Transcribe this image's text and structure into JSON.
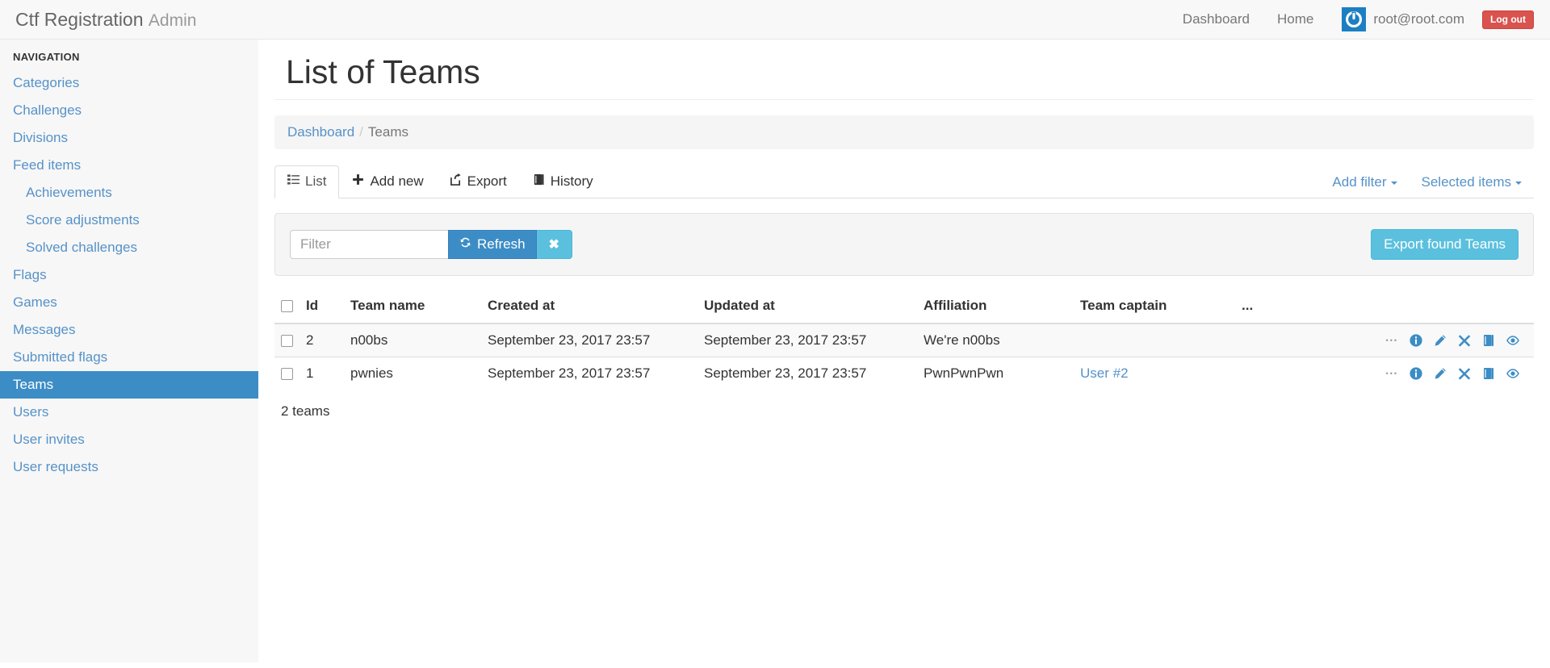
{
  "navbar": {
    "brand_main": "Ctf Registration",
    "brand_sub": "Admin",
    "links": [
      {
        "label": "Dashboard",
        "name": "nav-link-dashboard"
      },
      {
        "label": "Home",
        "name": "nav-link-home"
      }
    ],
    "user_email": "root@root.com",
    "logout_label": "Log out",
    "gravatar_icon": "power-icon",
    "accent_color": "#1b7fc4",
    "logout_color": "#d9534f"
  },
  "sidebar": {
    "header": "NAVIGATION",
    "active_color": "#3c8dc5",
    "link_color": "#5692c8",
    "items": [
      {
        "label": "Categories",
        "sub": false,
        "active": false
      },
      {
        "label": "Challenges",
        "sub": false,
        "active": false
      },
      {
        "label": "Divisions",
        "sub": false,
        "active": false
      },
      {
        "label": "Feed items",
        "sub": false,
        "active": false
      },
      {
        "label": "Achievements",
        "sub": true,
        "active": false
      },
      {
        "label": "Score adjustments",
        "sub": true,
        "active": false
      },
      {
        "label": "Solved challenges",
        "sub": true,
        "active": false
      },
      {
        "label": "Flags",
        "sub": false,
        "active": false
      },
      {
        "label": "Games",
        "sub": false,
        "active": false
      },
      {
        "label": "Messages",
        "sub": false,
        "active": false
      },
      {
        "label": "Submitted flags",
        "sub": false,
        "active": false
      },
      {
        "label": "Teams",
        "sub": false,
        "active": true
      },
      {
        "label": "Users",
        "sub": false,
        "active": false
      },
      {
        "label": "User invites",
        "sub": false,
        "active": false
      },
      {
        "label": "User requests",
        "sub": false,
        "active": false
      }
    ]
  },
  "page": {
    "title": "List of Teams"
  },
  "breadcrumb": {
    "root": "Dashboard",
    "separator": "/",
    "current": "Teams"
  },
  "tabs": [
    {
      "label": "List",
      "icon": "list-icon",
      "active": true,
      "name": "tab-list"
    },
    {
      "label": "Add new",
      "icon": "plus-icon",
      "active": false,
      "name": "tab-add-new"
    },
    {
      "label": "Export",
      "icon": "export-icon",
      "active": false,
      "name": "tab-export"
    },
    {
      "label": "History",
      "icon": "book-icon",
      "active": false,
      "name": "tab-history"
    }
  ],
  "tab_dropdowns": [
    {
      "label": "Add filter",
      "name": "add-filter-dropdown"
    },
    {
      "label": "Selected items",
      "name": "selected-items-dropdown"
    }
  ],
  "filter_panel": {
    "input_value": "",
    "input_placeholder": "Filter",
    "refresh_label": "Refresh",
    "refresh_icon": "refresh-icon",
    "clear_label": "✖",
    "export_found_label": "Export found Teams",
    "refresh_color": "#3c8dc5",
    "info_color": "#5bc0de"
  },
  "table": {
    "headers": [
      {
        "label": "",
        "name": "select-all-header"
      },
      {
        "label": "Id",
        "name": "header-id"
      },
      {
        "label": "Team name",
        "name": "header-team-name"
      },
      {
        "label": "Created at",
        "name": "header-created-at"
      },
      {
        "label": "Updated at",
        "name": "header-updated-at"
      },
      {
        "label": "Affiliation",
        "name": "header-affiliation"
      },
      {
        "label": "Team captain",
        "name": "header-team-captain"
      },
      {
        "label": "...",
        "name": "header-actions"
      }
    ],
    "rows": [
      {
        "id": "2",
        "team_name": "n00bs",
        "created_at": "September 23, 2017 23:57",
        "updated_at": "September 23, 2017 23:57",
        "affiliation": "We're n00bs",
        "team_captain": ""
      },
      {
        "id": "1",
        "team_name": "pwnies",
        "created_at": "September 23, 2017 23:57",
        "updated_at": "September 23, 2017 23:57",
        "affiliation": "PwnPwnPwn",
        "team_captain": "User #2"
      }
    ],
    "row_actions": [
      {
        "icon": "ellipsis-icon",
        "name": "row-more-actions"
      },
      {
        "icon": "info-icon",
        "name": "row-show-action"
      },
      {
        "icon": "pencil-icon",
        "name": "row-edit-action"
      },
      {
        "icon": "delete-icon",
        "name": "row-delete-action"
      },
      {
        "icon": "book-icon",
        "name": "row-history-action"
      },
      {
        "icon": "eye-icon",
        "name": "row-view-action"
      }
    ],
    "row_count_label": "2 teams"
  }
}
